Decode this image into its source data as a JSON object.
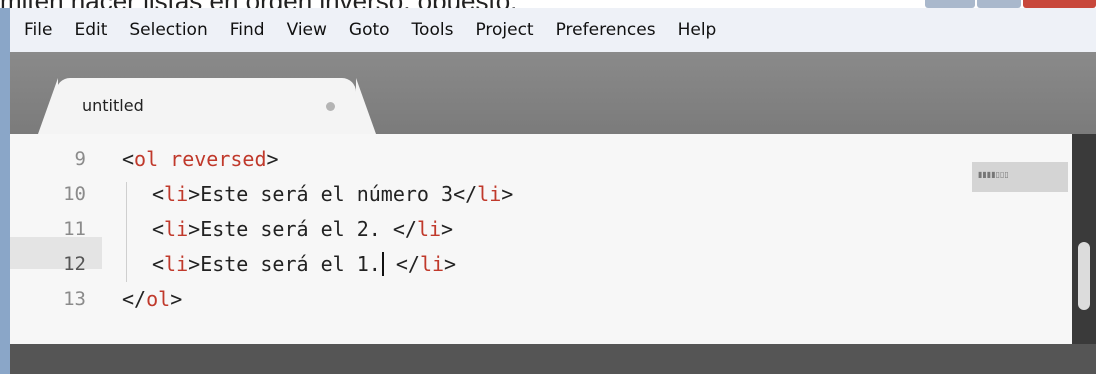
{
  "caption": "mitén hacer listas en orden inverso, opuesto:",
  "menu": {
    "items": [
      "File",
      "Edit",
      "Selection",
      "Find",
      "View",
      "Goto",
      "Tools",
      "Project",
      "Preferences",
      "Help"
    ]
  },
  "tab": {
    "title": "untitled"
  },
  "gutter": {
    "line_numbers": [
      "9",
      "10",
      "11",
      "12",
      "13"
    ],
    "current_line": "12"
  },
  "code": {
    "lines": [
      {
        "open": "<",
        "tag": "ol reversed",
        "close": ">",
        "text": "",
        "end": ""
      },
      {
        "open": "<",
        "tag": "li",
        "close": ">",
        "text": "Este será el número 3",
        "end": "li"
      },
      {
        "open": "<",
        "tag": "li",
        "close": ">",
        "text": "Este será el 2. ",
        "end": "li"
      },
      {
        "open": "<",
        "tag": "li",
        "close": ">",
        "text": "Este será el 1.",
        "after_caret": " ",
        "end": "li"
      },
      {
        "open": "</",
        "tag": "ol",
        "close": ">",
        "text": "",
        "end": ""
      }
    ]
  },
  "colors": {
    "tag": "#c0392b",
    "menubar": "#eef1f7",
    "tabbar": "#7b7b7b",
    "editor_bg": "#f7f7f7",
    "window_frame": "#8aa6c8"
  }
}
